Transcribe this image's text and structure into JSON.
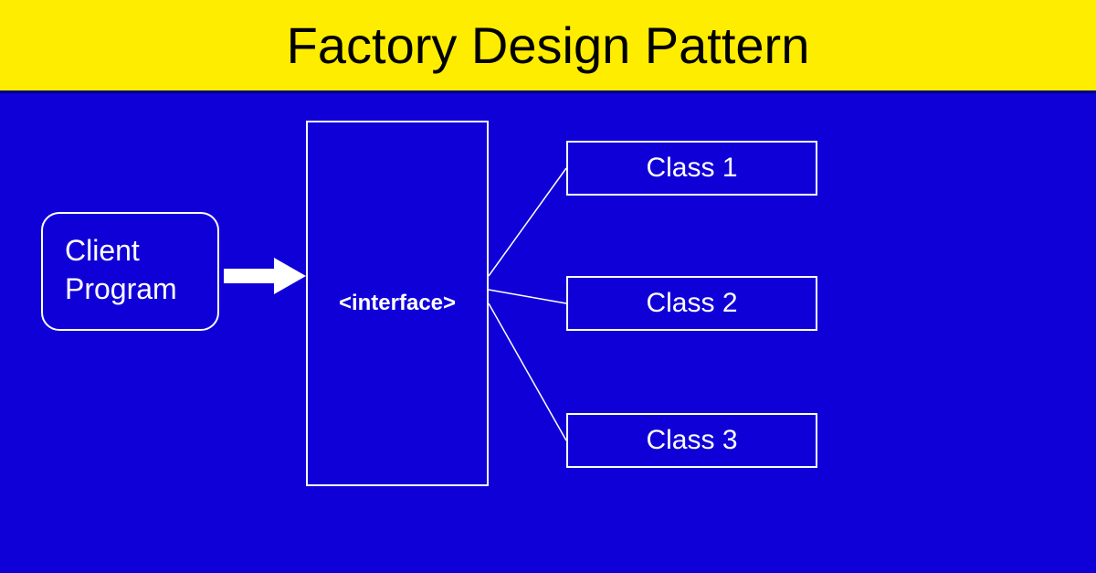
{
  "header": {
    "title": "Factory Design Pattern"
  },
  "diagram": {
    "client_label_line1": "Client",
    "client_label_line2": "Program",
    "interface_label": "<interface>",
    "classes": [
      "Class 1",
      "Class 2",
      "Class 3"
    ]
  },
  "colors": {
    "header_bg": "#ffed00",
    "diagram_bg": "#1000d8",
    "box_border": "#ffffff",
    "text_light": "#ffffff",
    "text_dark": "#000000"
  }
}
